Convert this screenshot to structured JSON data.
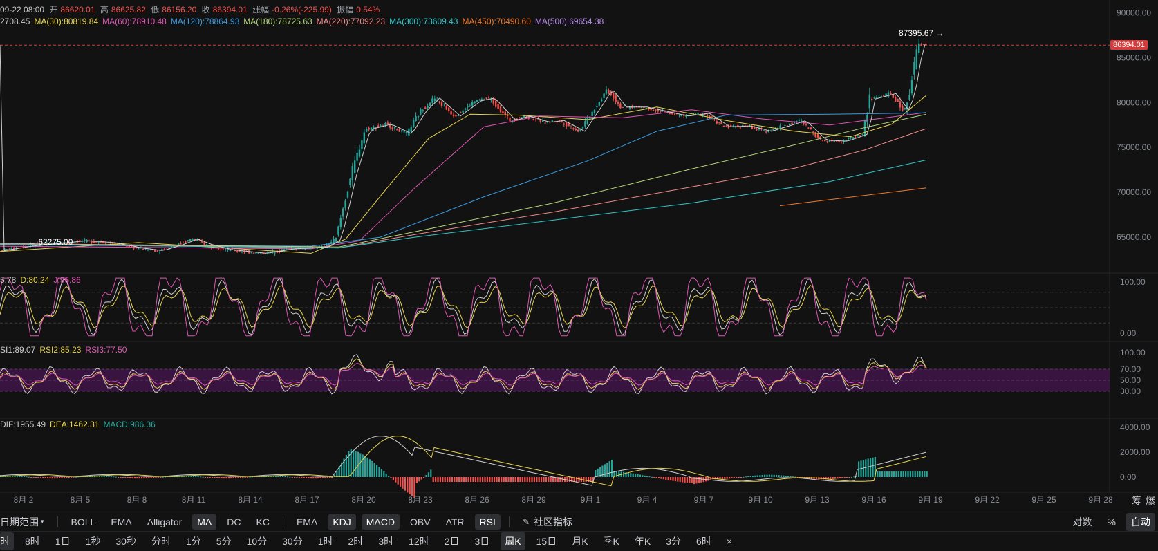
{
  "header": {
    "date": "09-22 08:00",
    "open_label": "开",
    "open": "86620.01",
    "high_label": "高",
    "high": "86625.82",
    "low_label": "低",
    "low": "86156.20",
    "close_label": "收",
    "close": "86394.01",
    "change_label": "涨幅",
    "change": "-0.26%(-225.99)",
    "amp_label": "振幅",
    "amp": "0.54%"
  },
  "ma_legend": [
    {
      "text": "2708.45",
      "color": "#c8c8c8"
    },
    {
      "text": "MA(30):80819.84",
      "color": "#e8d44d"
    },
    {
      "text": "MA(60):78910.48",
      "color": "#e055b3"
    },
    {
      "text": "MA(120):78864.93",
      "color": "#3a9be0"
    },
    {
      "text": "MA(180):78725.63",
      "color": "#b5d67a"
    },
    {
      "text": "MA(220):77092.23",
      "color": "#f08a8a"
    },
    {
      "text": "MA(300):73609.43",
      "color": "#2fc7c9"
    },
    {
      "text": "MA(450):70490.60",
      "color": "#f07a2a"
    },
    {
      "text": "MA(500):69654.38",
      "color": "#b48ce8"
    }
  ],
  "kdj_legend": [
    {
      "text": "5.78",
      "color": "#c8c8c8"
    },
    {
      "text": "D:80.24",
      "color": "#e8d44d"
    },
    {
      "text": "J:96.86",
      "color": "#e055b3"
    }
  ],
  "rsi_legend": [
    {
      "text": "SI1:89.07",
      "color": "#c8c8c8"
    },
    {
      "text": "RSI2:85.23",
      "color": "#e8d44d"
    },
    {
      "text": "RSI3:77.50",
      "color": "#e055b3"
    }
  ],
  "macd_legend": [
    {
      "text": "DIF:1955.49",
      "color": "#c8c8c8"
    },
    {
      "text": "DEA:1462.31",
      "color": "#e8d44d"
    },
    {
      "text": "MACD:986.36",
      "color": "#26a69a"
    }
  ],
  "price_axis": [
    "90000.00",
    "85000.00",
    "80000.00",
    "75000.00",
    "70000.00",
    "65000.00"
  ],
  "current_price": "86394.01",
  "high_marker": "87395.67 →",
  "low_marker": "← 62275.00",
  "kdj_axis": [
    "100.00",
    "0.00"
  ],
  "rsi_axis": [
    "100.00",
    "70.00",
    "50.00",
    "30.00"
  ],
  "macd_axis": [
    "4000.00",
    "2000.00",
    "0.00"
  ],
  "dates": [
    "8月 2",
    "8月 5",
    "8月 8",
    "8月 11",
    "8月 14",
    "8月 17",
    "8月 20",
    "8月 23",
    "8月 26",
    "8月 29",
    "9月 1",
    "9月 4",
    "9月 7",
    "9月 10",
    "9月 13",
    "9月 16",
    "9月 19",
    "9月 22",
    "9月 25",
    "9月 28"
  ],
  "side_labels": [
    "筹",
    "爆"
  ],
  "indicator_bar": {
    "range_label": "日期范围",
    "main": [
      "BOLL",
      "EMA",
      "Alligator",
      "MA",
      "DC",
      "KC"
    ],
    "main_active": "MA",
    "sub": [
      "EMA",
      "KDJ",
      "MACD",
      "OBV",
      "ATR",
      "RSI"
    ],
    "sub_active": [
      "KDJ",
      "MACD",
      "RSI"
    ],
    "community": "社区指标",
    "right": {
      "log": "对数",
      "pct": "%",
      "auto": "自动"
    }
  },
  "timeframes": [
    "时",
    "8时",
    "1日",
    "1秒",
    "30秒",
    "分时",
    "1分",
    "5分",
    "10分",
    "30分",
    "1时",
    "2时",
    "3时",
    "12时",
    "2日",
    "3日",
    "周K",
    "15日",
    "月K",
    "季K",
    "年K",
    "3分",
    "6时"
  ],
  "tf_active": [
    "时",
    "周K"
  ],
  "close_glyph": "×",
  "colors": {
    "up": "#26a69a",
    "down": "#ef5350",
    "bg": "#121212"
  },
  "chart_data": {
    "type": "candlestick",
    "x_range": [
      "8月 1",
      "9月 29"
    ],
    "ylim": [
      61000,
      90500
    ],
    "price_path": [
      [
        0,
        63500
      ],
      [
        40,
        64000
      ],
      [
        80,
        64300
      ],
      [
        120,
        64600
      ],
      [
        160,
        64400
      ],
      [
        200,
        63800
      ],
      [
        230,
        63500
      ],
      [
        260,
        64200
      ],
      [
        280,
        64800
      ],
      [
        300,
        64200
      ],
      [
        330,
        63600
      ],
      [
        380,
        63200
      ],
      [
        420,
        63700
      ],
      [
        470,
        63900
      ],
      [
        488,
        64800
      ],
      [
        510,
        72000
      ],
      [
        530,
        77000
      ],
      [
        560,
        77600
      ],
      [
        590,
        76500
      ],
      [
        610,
        79000
      ],
      [
        630,
        80500
      ],
      [
        660,
        78500
      ],
      [
        690,
        80200
      ],
      [
        710,
        80500
      ],
      [
        740,
        78000
      ],
      [
        760,
        78500
      ],
      [
        790,
        77800
      ],
      [
        810,
        78000
      ],
      [
        840,
        76800
      ],
      [
        868,
        80000
      ],
      [
        880,
        81500
      ],
      [
        900,
        79500
      ],
      [
        930,
        79500
      ],
      [
        960,
        79000
      ],
      [
        990,
        78500
      ],
      [
        1020,
        78800
      ],
      [
        1050,
        77300
      ],
      [
        1080,
        77400
      ],
      [
        1110,
        76800
      ],
      [
        1140,
        77500
      ],
      [
        1160,
        78000
      ],
      [
        1190,
        75800
      ],
      [
        1220,
        75700
      ],
      [
        1250,
        76500
      ],
      [
        1260,
        80400
      ],
      [
        1290,
        81000
      ],
      [
        1310,
        79000
      ],
      [
        1320,
        82000
      ],
      [
        1330,
        86500
      ],
      [
        1340,
        86400
      ]
    ],
    "series": [
      {
        "name": "MA(30)",
        "values": [
          [
            0,
            63400
          ],
          [
            200,
            64400
          ],
          [
            450,
            63200
          ],
          [
            500,
            64800
          ],
          [
            560,
            70500
          ],
          [
            620,
            76000
          ],
          [
            680,
            78700
          ],
          [
            750,
            78600
          ],
          [
            850,
            78100
          ],
          [
            950,
            79500
          ],
          [
            1050,
            78000
          ],
          [
            1150,
            76800
          ],
          [
            1230,
            76200
          ],
          [
            1290,
            77600
          ],
          [
            1340,
            80800
          ]
        ]
      },
      {
        "name": "MA(60)",
        "values": [
          [
            0,
            64000
          ],
          [
            450,
            63700
          ],
          [
            520,
            64600
          ],
          [
            600,
            70500
          ],
          [
            700,
            77300
          ],
          [
            780,
            78500
          ],
          [
            900,
            78300
          ],
          [
            1000,
            79200
          ],
          [
            1100,
            78200
          ],
          [
            1200,
            77500
          ],
          [
            1340,
            78900
          ]
        ]
      },
      {
        "name": "MA(120)",
        "values": [
          [
            0,
            64200
          ],
          [
            450,
            64000
          ],
          [
            550,
            65000
          ],
          [
            700,
            69500
          ],
          [
            850,
            73500
          ],
          [
            950,
            76800
          ],
          [
            1050,
            78600
          ],
          [
            1200,
            78700
          ],
          [
            1340,
            78850
          ]
        ]
      },
      {
        "name": "MA(180)",
        "values": [
          [
            0,
            64300
          ],
          [
            490,
            63900
          ],
          [
            600,
            65600
          ],
          [
            800,
            68800
          ],
          [
            1000,
            72600
          ],
          [
            1150,
            75300
          ],
          [
            1250,
            77200
          ],
          [
            1340,
            78700
          ]
        ]
      },
      {
        "name": "MA(220)",
        "values": [
          [
            0,
            64300
          ],
          [
            490,
            63800
          ],
          [
            600,
            65300
          ],
          [
            800,
            67800
          ],
          [
            1000,
            70600
          ],
          [
            1150,
            72700
          ],
          [
            1250,
            74700
          ],
          [
            1340,
            77100
          ]
        ]
      },
      {
        "name": "MA(300)",
        "values": [
          [
            0,
            64200
          ],
          [
            490,
            63800
          ],
          [
            600,
            65000
          ],
          [
            800,
            66900
          ],
          [
            1000,
            68800
          ],
          [
            1200,
            71200
          ],
          [
            1340,
            73600
          ]
        ]
      },
      {
        "name": "MA(450)",
        "values": [
          [
            1128,
            68500
          ],
          [
            1340,
            70500
          ]
        ]
      }
    ]
  }
}
